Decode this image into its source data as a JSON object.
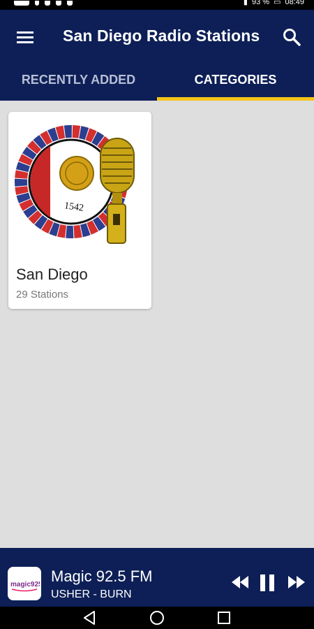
{
  "app": {
    "title": "San Diego Radio Stations"
  },
  "status_bar": {
    "battery": "93 %",
    "time": "08:49"
  },
  "tabs": [
    {
      "label": "RECENTLY ADDED",
      "selected": false
    },
    {
      "label": "CATEGORIES",
      "selected": true
    }
  ],
  "categories": [
    {
      "name": "San Diego",
      "stations": "29 Stations",
      "image_text": "1542"
    }
  ],
  "player": {
    "station": "Magic 92.5 FM",
    "track": "USHER - BURN",
    "logo_text": "magic925",
    "state": "playing"
  },
  "icons": {
    "menu": "menu-icon",
    "search": "search-icon",
    "rewind": "rewind-icon",
    "pause": "pause-icon",
    "fast_forward": "fast-forward-icon",
    "back": "back-icon",
    "home": "home-icon",
    "recents": "recents-icon"
  },
  "colors": {
    "primary": "#0d1f56",
    "accent": "#f5c518",
    "background": "#dedede"
  }
}
